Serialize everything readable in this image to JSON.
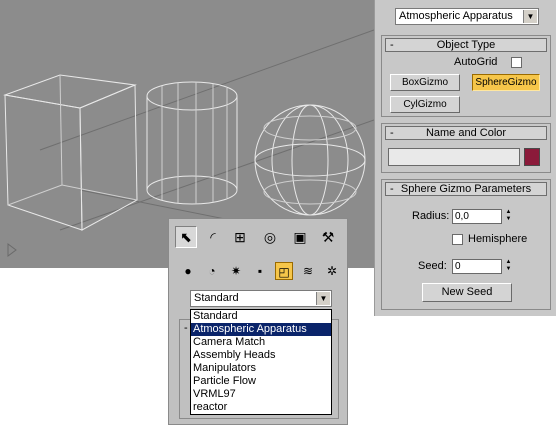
{
  "create_panel": {
    "category_dropdown": "Atmospheric Apparatus",
    "object_type": {
      "header": "Object Type",
      "collapse_symbol": "-",
      "autogrid_label": "AutoGrid",
      "autogrid_checked": false,
      "buttons": [
        "BoxGizmo",
        "SphereGizmo",
        "CylGizmo"
      ],
      "active_button": "SphereGizmo"
    },
    "name_and_color": {
      "header": "Name and Color",
      "collapse_symbol": "-",
      "name_value": "",
      "swatch_color": "#8b1a3a"
    },
    "sphere_gizmo_parameters": {
      "header": "Sphere Gizmo Parameters",
      "collapse_symbol": "-",
      "radius_label": "Radius:",
      "radius_value": "0,0",
      "hemisphere_label": "Hemisphere",
      "hemisphere_checked": false,
      "seed_label": "Seed:",
      "seed_value": "0",
      "new_seed_button": "New Seed"
    }
  },
  "command_panel": {
    "tabs": [
      "create-tab",
      "modify-tab",
      "hierarchy-tab",
      "motion-tab",
      "display-tab",
      "utilities-tab"
    ],
    "active_tab": "create-tab",
    "subcategories": [
      "geometry",
      "shapes",
      "lights",
      "cameras",
      "helpers",
      "space-warps",
      "systems"
    ],
    "active_subcategory": "helpers",
    "dropdown_value": "Standard",
    "dropdown_options": [
      "Standard",
      "Atmospheric Apparatus",
      "Camera Match",
      "Assembly Heads",
      "Manipulators",
      "Particle Flow",
      "VRML97",
      "reactor"
    ],
    "highlighted_option": "Atmospheric Apparatus",
    "behind_rollout_symbol": "-"
  },
  "colors": {
    "viewport_bg": "#8c8c8c",
    "panel_bg": "#c8c8c8",
    "active_button": "#f6c64a",
    "highlight": "#0a246a"
  }
}
